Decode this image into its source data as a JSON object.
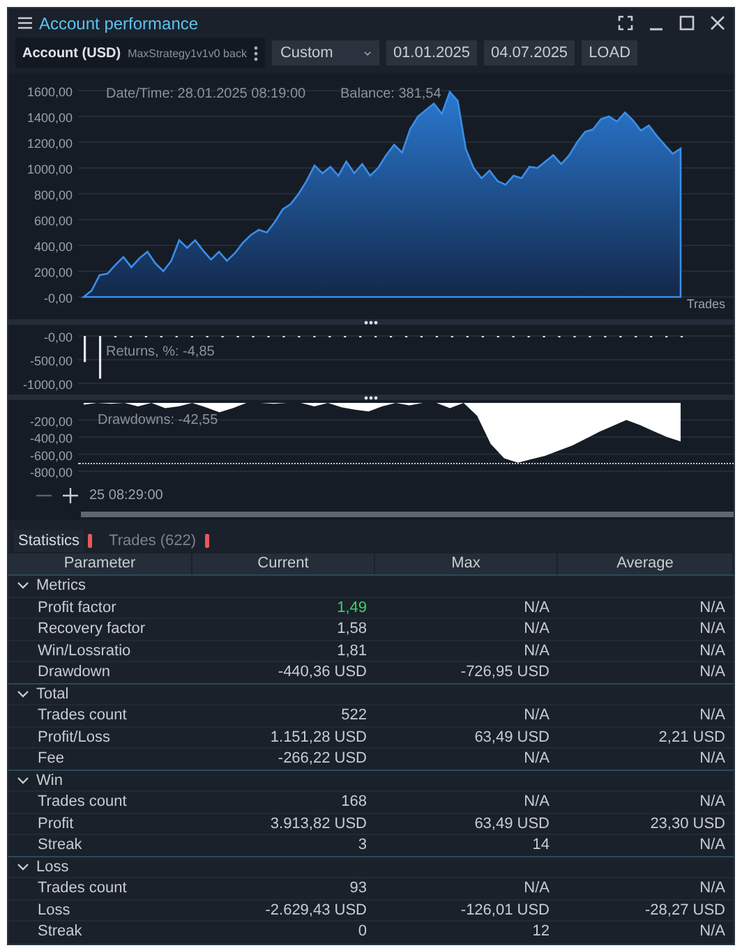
{
  "window": {
    "title": "Account performance"
  },
  "toolbar": {
    "account": "Account (USD)",
    "strategy": "MaxStrategy1v1v0 back",
    "period": "Custom",
    "date_from": "01.01.2025",
    "date_to": "04.07.2025",
    "load": "LOAD"
  },
  "balance_chart": {
    "date_time": "Date/Time: 28.01.2025 08:19:00",
    "balance": "Balance: 381,54",
    "chart_data": {
      "type": "area",
      "xlabel": "Trades",
      "ylim": [
        0,
        1600
      ],
      "grid": true,
      "yticks": [
        {
          "value": 1600,
          "label": "1600,00"
        },
        {
          "value": 1400,
          "label": "1400,00"
        },
        {
          "value": 1200,
          "label": "1200,00"
        },
        {
          "value": 1000,
          "label": "1000,00"
        },
        {
          "value": 800,
          "label": "800,00"
        },
        {
          "value": 600,
          "label": "600,00"
        },
        {
          "value": 400,
          "label": "400,00"
        },
        {
          "value": 200,
          "label": "200,00"
        },
        {
          "value": 0,
          "label": "-0,00"
        }
      ],
      "values": [
        0,
        50,
        170,
        180,
        250,
        310,
        230,
        300,
        350,
        260,
        200,
        280,
        440,
        380,
        440,
        360,
        290,
        350,
        280,
        340,
        420,
        480,
        520,
        500,
        580,
        680,
        720,
        800,
        900,
        1020,
        960,
        1010,
        940,
        1050,
        960,
        1030,
        940,
        1000,
        1100,
        1180,
        1120,
        1300,
        1400,
        1450,
        1500,
        1420,
        1590,
        1520,
        1150,
        1000,
        920,
        980,
        900,
        870,
        940,
        920,
        1010,
        1000,
        1050,
        1100,
        1030,
        1100,
        1200,
        1280,
        1300,
        1380,
        1400,
        1360,
        1430,
        1370,
        1290,
        1330,
        1250,
        1180,
        1110,
        1150
      ]
    }
  },
  "returns_chart": {
    "label": "Returns, %: -4,85",
    "chart_data": {
      "type": "bar",
      "ylim": [
        -1000,
        0
      ],
      "yticks": [
        {
          "value": 0,
          "label": "-0,00"
        },
        {
          "value": -500,
          "label": "-500,00"
        },
        {
          "value": -1000,
          "label": "-1000,00"
        }
      ],
      "values": [
        -550,
        -900,
        0,
        0,
        0,
        0,
        0,
        0,
        0,
        0,
        0,
        0,
        0,
        0,
        0,
        0,
        0,
        0,
        0,
        0,
        0,
        0,
        0,
        0,
        0,
        0,
        0,
        0,
        0,
        0,
        0,
        0,
        0,
        0,
        0,
        0,
        0,
        0,
        0,
        0
      ]
    }
  },
  "drawdown_chart": {
    "label": "Drawdowns: -42,55",
    "time": "25 08:29:00",
    "chart_data": {
      "type": "area",
      "ylim": [
        -800,
        0
      ],
      "grid": true,
      "yticks": [
        {
          "value": -200,
          "label": "-200,00"
        },
        {
          "value": -400,
          "label": "-400,00"
        },
        {
          "value": -600,
          "label": "-600,00"
        },
        {
          "value": -800,
          "label": "-800,00"
        }
      ],
      "values": [
        -20,
        0,
        -10,
        0,
        -40,
        0,
        -60,
        -40,
        0,
        -50,
        -110,
        -60,
        0,
        0,
        -10,
        0,
        0,
        -40,
        0,
        -50,
        -80,
        -100,
        -40,
        0,
        -30,
        0,
        0,
        -60,
        0,
        -150,
        -480,
        -650,
        -700,
        -660,
        -620,
        -560,
        -500,
        -420,
        -340,
        -270,
        -200,
        -260,
        -330,
        -400,
        -450
      ]
    }
  },
  "tabs": [
    {
      "label": "Statistics",
      "selected": true
    },
    {
      "label": "Trades (622)",
      "selected": false
    }
  ],
  "table": {
    "columns": [
      "Parameter",
      "Current",
      "Max",
      "Average"
    ],
    "groups": [
      {
        "name": "Metrics",
        "expanded": true,
        "rows": [
          {
            "cells": [
              "Profit factor",
              "1,49",
              "N/A",
              "N/A"
            ],
            "highlight": true
          },
          {
            "cells": [
              "Recovery factor",
              "1,58",
              "N/A",
              "N/A"
            ],
            "highlight": false
          },
          {
            "cells": [
              "Win/Lossratio",
              "1,81",
              "N/A",
              "N/A"
            ],
            "highlight": false
          },
          {
            "cells": [
              "Drawdown",
              "-440,36 USD",
              "-726,95 USD",
              "N/A"
            ],
            "highlight": false
          }
        ]
      },
      {
        "name": "Total",
        "expanded": true,
        "rows": [
          {
            "cells": [
              "Trades count",
              "522",
              "N/A",
              "N/A"
            ],
            "highlight": false
          },
          {
            "cells": [
              "Profit/Loss",
              "1.151,28 USD",
              "63,49 USD",
              "2,21 USD"
            ],
            "highlight": false
          },
          {
            "cells": [
              "Fee",
              "-266,22 USD",
              "N/A",
              "N/A"
            ],
            "highlight": false
          }
        ]
      },
      {
        "name": "Win",
        "expanded": true,
        "rows": [
          {
            "cells": [
              "Trades count",
              "168",
              "N/A",
              "N/A"
            ],
            "highlight": false
          },
          {
            "cells": [
              "Profit",
              "3.913,82 USD",
              "63,49 USD",
              "23,30 USD"
            ],
            "highlight": false
          },
          {
            "cells": [
              "Streak",
              "3",
              "14",
              "N/A"
            ],
            "highlight": false
          }
        ]
      },
      {
        "name": "Loss",
        "expanded": true,
        "rows": [
          {
            "cells": [
              "Trades count",
              "93",
              "N/A",
              "N/A"
            ],
            "highlight": false
          },
          {
            "cells": [
              "Loss",
              "-2.629,43 USD",
              "-126,01 USD",
              "-28,27 USD"
            ],
            "highlight": false
          },
          {
            "cells": [
              "Streak",
              "0",
              "12",
              "N/A"
            ],
            "highlight": false
          }
        ]
      }
    ]
  }
}
